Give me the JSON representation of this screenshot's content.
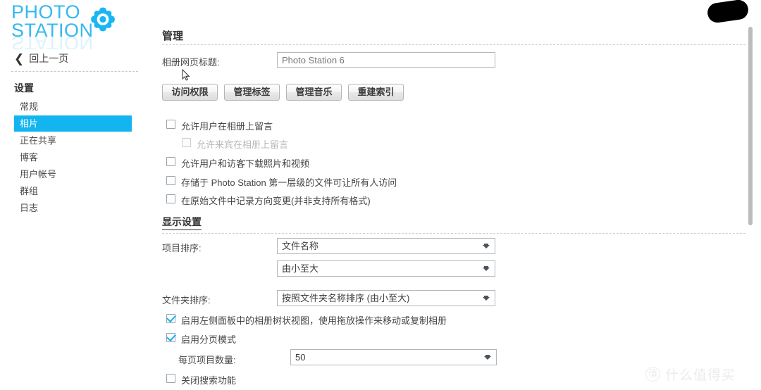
{
  "sidebar": {
    "logo": {
      "line1": "PHOTO",
      "line2": "STATION",
      "gear_icon": "gear-icon"
    },
    "back_link": {
      "label": "回上一页",
      "icon": "chevron-left-icon"
    },
    "section_title": "设置",
    "items": [
      {
        "label": "常规",
        "selected": false
      },
      {
        "label": "相片",
        "selected": true
      },
      {
        "label": "正在共享",
        "selected": false
      },
      {
        "label": "博客",
        "selected": false
      },
      {
        "label": "用户帐号",
        "selected": false
      },
      {
        "label": "群组",
        "selected": false
      },
      {
        "label": "日志",
        "selected": false
      }
    ]
  },
  "main": {
    "page_title": "管理",
    "album_title_label": "相册网页标题:",
    "album_title_value": "Photo Station 6",
    "buttons": [
      "访问权限",
      "管理标签",
      "管理音乐",
      "重建索引"
    ],
    "checkboxes": [
      {
        "label": "允许用户在相册上留言",
        "checked": false,
        "disabled": false
      },
      {
        "label": "允许来宾在相册上留言",
        "checked": false,
        "disabled": true
      },
      {
        "label": "允许用户和访客下载照片和视频",
        "checked": false,
        "disabled": false
      },
      {
        "label": "存储于 Photo Station 第一层级的文件可让所有人访问",
        "checked": false,
        "disabled": false
      },
      {
        "label": "在原始文件中记录方向变更(并非支持所有格式)",
        "checked": false,
        "disabled": false
      }
    ],
    "display_section": {
      "heading": "显示设置",
      "item_sort_label": "项目排序:",
      "item_sort_value": "文件名称",
      "item_order_value": "由小至大",
      "folder_sort_label": "文件夹排序:",
      "folder_sort_value": "按照文件夹名称排序 (由小至大)",
      "tree_view_label": "启用左侧面板中的相册树状视图，使用拖放操作来移动或复制相册",
      "tree_view_checked": true,
      "pagination_label": "启用分页模式",
      "pagination_checked": true,
      "items_per_page_label": "每页项目数量:",
      "items_per_page_value": "50",
      "disable_search_label": "关闭搜索功能",
      "disable_search_checked": false
    }
  },
  "overlays": {
    "watermark_badge": "值",
    "watermark_text": "什么值得买"
  },
  "colors": {
    "accent": "#12b5f0",
    "logo": "#35b9ef",
    "check": "#18b0f0"
  }
}
